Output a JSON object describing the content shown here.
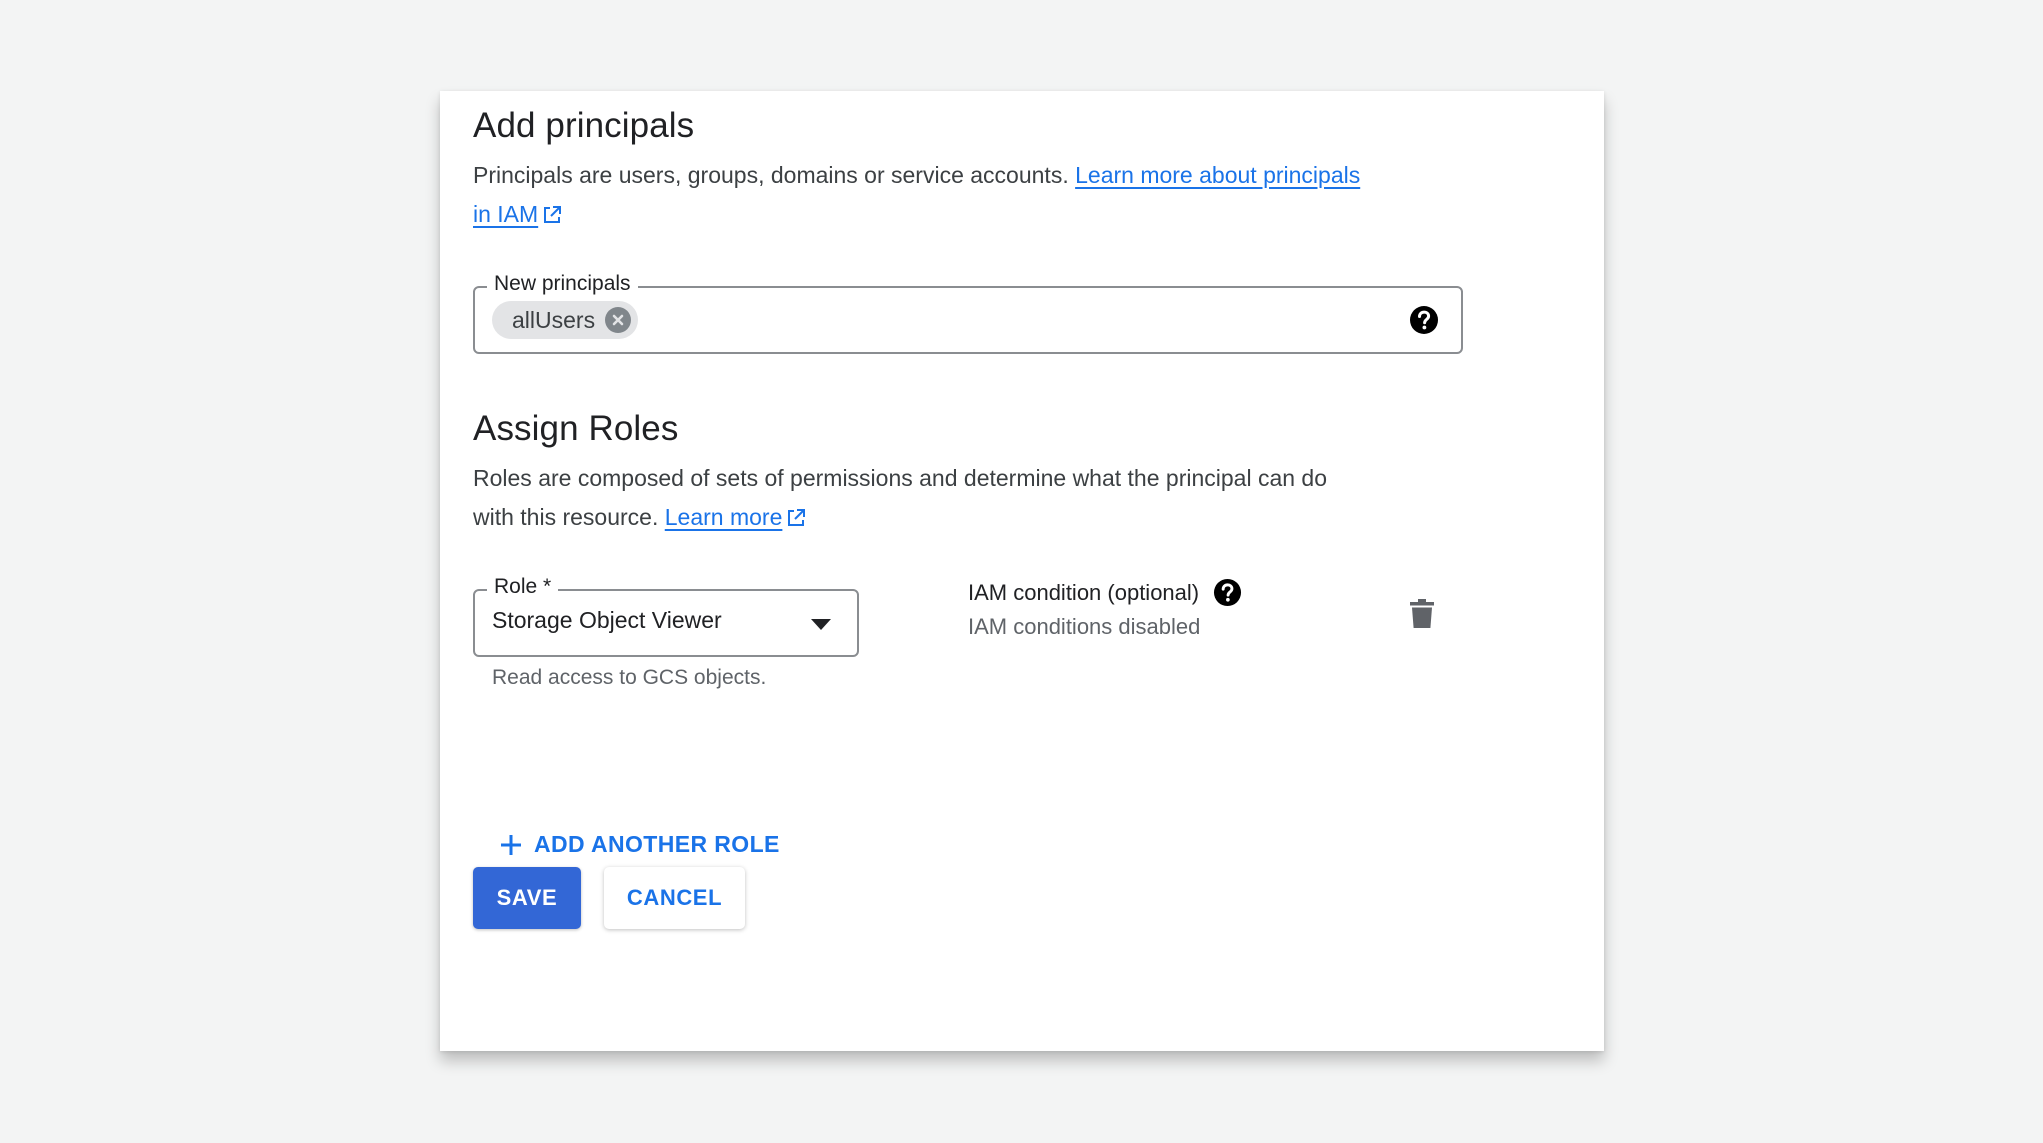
{
  "principals_section": {
    "title": "Add principals",
    "description": "Principals are users, groups, domains or service accounts.",
    "link_line1": "Learn more about principals",
    "link_line2": "in IAM",
    "field_label": "New principals",
    "chips": [
      "allUsers"
    ]
  },
  "roles_section": {
    "title": "Assign Roles",
    "description_line1": "Roles are composed of sets of permissions and determine what the principal can do",
    "description_line2": "with this resource.",
    "link": "Learn more",
    "role_label": "Role *",
    "role_value": "Storage Object Viewer",
    "role_hint": "Read access to GCS objects.",
    "condition_title": "IAM condition (optional)",
    "condition_status": "IAM conditions disabled",
    "add_role_label": "ADD ANOTHER ROLE"
  },
  "actions": {
    "save_label": "SAVE",
    "cancel_label": "CANCEL"
  },
  "colors": {
    "accent": "#1a73e8",
    "primary_button": "#3367d6",
    "background": "#f3f4f4"
  },
  "icons": [
    "external-link-icon",
    "chip-close-icon",
    "help-icon",
    "dropdown-arrow-icon",
    "trash-icon",
    "plus-icon"
  ]
}
